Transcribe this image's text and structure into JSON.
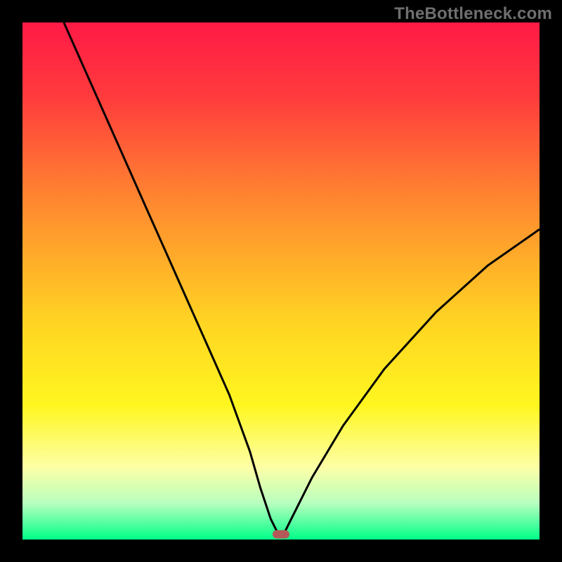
{
  "watermark": "TheBottleneck.com",
  "chart_data": {
    "type": "line",
    "title": "",
    "xlabel": "",
    "ylabel": "",
    "xlim": [
      0,
      100
    ],
    "ylim": [
      0,
      100
    ],
    "grid": false,
    "background_gradient": {
      "stops": [
        {
          "offset": 0.0,
          "color": "#ff1a46"
        },
        {
          "offset": 0.14,
          "color": "#ff3a3d"
        },
        {
          "offset": 0.36,
          "color": "#ff8d2f"
        },
        {
          "offset": 0.58,
          "color": "#ffd423"
        },
        {
          "offset": 0.74,
          "color": "#fff61f"
        },
        {
          "offset": 0.86,
          "color": "#fdffa6"
        },
        {
          "offset": 0.93,
          "color": "#b8ffbf"
        },
        {
          "offset": 1.0,
          "color": "#00ff88"
        }
      ]
    },
    "optimum_marker": {
      "x": 50,
      "y": 1,
      "color": "#b35a58"
    },
    "x": [
      8,
      12,
      16,
      20,
      24,
      28,
      32,
      36,
      40,
      44,
      46,
      48,
      49.5,
      50,
      50.5,
      52,
      56,
      62,
      70,
      80,
      90,
      100
    ],
    "series": [
      {
        "name": "bottleneck-curve",
        "values": [
          100,
          91,
          82,
          73,
          64,
          55,
          46,
          37,
          28,
          17,
          10,
          4,
          1,
          0.5,
          1,
          4,
          12,
          22,
          33,
          44,
          53,
          60
        ]
      }
    ]
  }
}
